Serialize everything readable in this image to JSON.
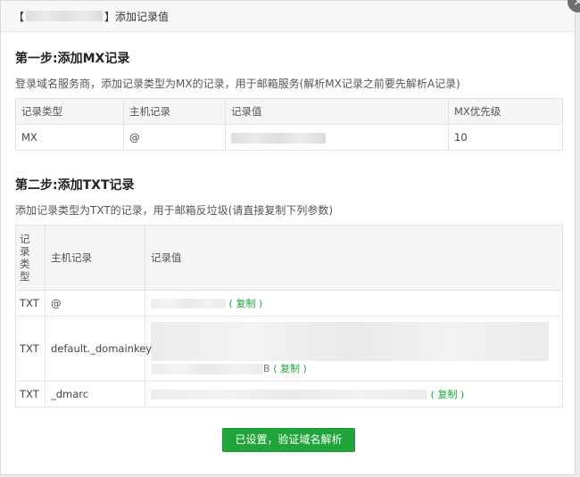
{
  "dialog": {
    "title_prefix": "【",
    "title_suffix": "】添加记录值",
    "close_glyph": "×"
  },
  "mx_section": {
    "heading": "第一步:添加MX记录",
    "description": "登录域名服务商，添加记录类型为MX的记录，用于邮箱服务(解析MX记录之前要先解析A记录)",
    "columns": [
      "记录类型",
      "主机记录",
      "记录值",
      "MX优先级"
    ],
    "row": {
      "type": "MX",
      "host": "@",
      "priority": "10"
    }
  },
  "txt_section": {
    "heading": "第二步:添加TXT记录",
    "description": "添加记录类型为TXT的记录，用于邮箱反垃圾(请直接复制下列参数)",
    "columns": [
      "记录类型",
      "主机记录",
      "记录值"
    ],
    "rows": [
      {
        "type": "TXT",
        "host": "@",
        "copy": "( 复制 )"
      },
      {
        "type": "TXT",
        "host": "default._domainkey",
        "value_tail": "B",
        "copy": "( 复制 )"
      },
      {
        "type": "TXT",
        "host": "_dmarc",
        "copy": "( 复制 )"
      }
    ]
  },
  "footer": {
    "verify_label": "已设置，验证域名解析"
  },
  "colors": {
    "accent": "#20a53a"
  }
}
